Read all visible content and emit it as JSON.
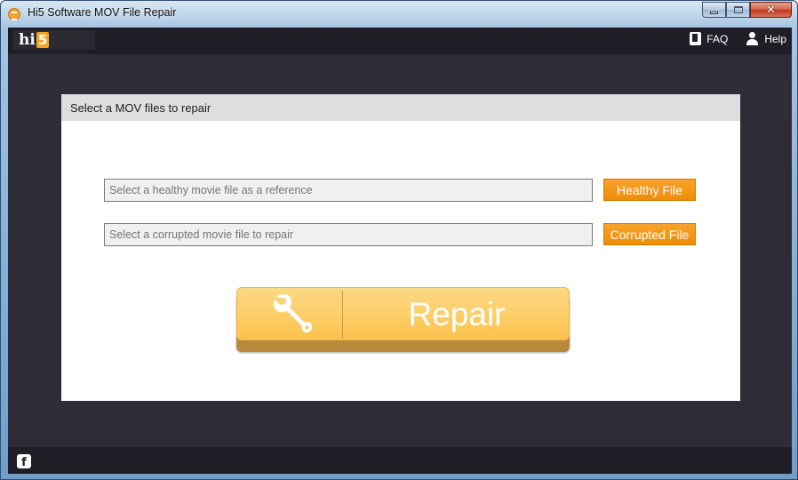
{
  "window": {
    "title": "Hi5 Software MOV File Repair",
    "controls": {
      "minimize": "minimize",
      "maximize": "maximize",
      "close": "✕"
    }
  },
  "header": {
    "logo_text": "hi",
    "logo_accent": "5",
    "nav": [
      {
        "label": "FAQ",
        "icon": "book-icon"
      },
      {
        "label": "Help",
        "icon": "user-icon"
      }
    ]
  },
  "panel": {
    "title": "Select a MOV files to repair",
    "healthy": {
      "placeholder": "Select a healthy movie file as a reference",
      "value": "",
      "button_label": "Healthy File"
    },
    "corrupted": {
      "placeholder": "Select a corrupted movie file to repair",
      "value": "",
      "button_label": "Corrupted File"
    },
    "repair_label": "Repair",
    "repair_icon": "wrench-icon"
  },
  "footer": {
    "social_icon": "facebook-icon",
    "social_glyph": "f"
  },
  "colors": {
    "accent_orange": "#ef8c0c",
    "repair_button": "#fdcf6a",
    "background_dark": "#2f2c38",
    "header_dark": "#1f1d26",
    "panel_header": "#dedede"
  }
}
